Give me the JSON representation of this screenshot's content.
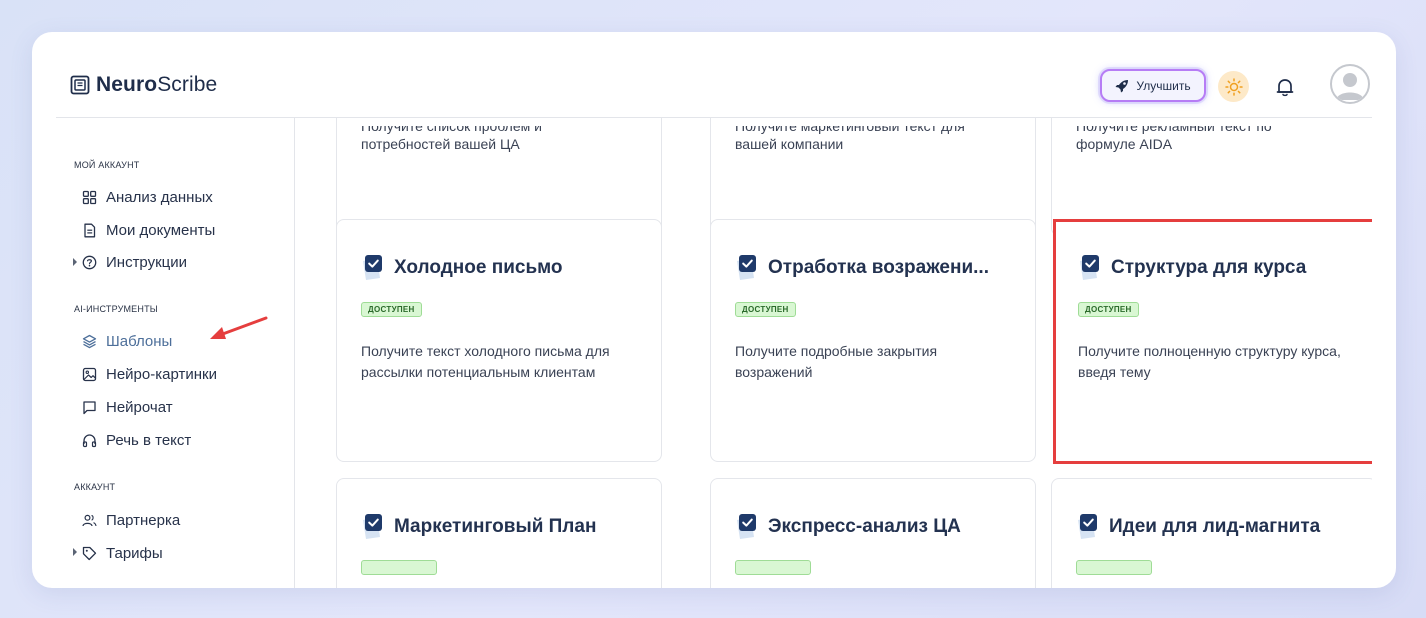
{
  "app": {
    "logo_bold": "Neuro",
    "logo_rest": "Scribe"
  },
  "header": {
    "upgrade_label": "Улучшить",
    "icons": [
      "rocket-icon",
      "sun-icon",
      "bell-icon",
      "avatar"
    ]
  },
  "sidebar": {
    "sections": [
      {
        "title": "МОЙ АККАУНТ",
        "items": [
          {
            "label": "Анализ данных",
            "icon": "grid-icon"
          },
          {
            "label": "Мои документы",
            "icon": "document-icon",
            "expandable": true
          },
          {
            "label": "Инструкции",
            "icon": "question-icon"
          }
        ]
      },
      {
        "title": "AI-ИНСТРУМЕНТЫ",
        "items": [
          {
            "label": "Шаблоны",
            "icon": "layers-icon",
            "active": true
          },
          {
            "label": "Нейро-картинки",
            "icon": "image-icon"
          },
          {
            "label": "Нейрочат",
            "icon": "chat-icon"
          },
          {
            "label": "Речь в текст",
            "icon": "headphones-icon"
          }
        ]
      },
      {
        "title": "АККАУНТ",
        "items": [
          {
            "label": "Партнерка",
            "icon": "users-icon",
            "expandable": true
          },
          {
            "label": "Тарифы",
            "icon": "tag-icon"
          }
        ]
      }
    ]
  },
  "cards_top_partial": [
    {
      "desc_line1": "Получите список проблем и",
      "desc_line2": "потребностей вашей ЦА"
    },
    {
      "desc_line1": "Получите маркетинговый текст для",
      "desc_line2": "вашей компании"
    },
    {
      "desc_line1": "Получите рекламный текст по",
      "desc_line2": "формуле AIDA"
    }
  ],
  "cards": [
    {
      "title": "Холодное письмо",
      "badge": "ДОСТУПЕН",
      "description": "Получите текст холодного письма для рассылки потенциальным клиентам"
    },
    {
      "title": "Отработка возражени...",
      "badge": "ДОСТУПЕН",
      "description": "Получите подробные закрытия возражений"
    },
    {
      "title": "Структура для курса",
      "badge": "ДОСТУПЕН",
      "description": "Получите полноценную структуру курса, введя тему",
      "selected": true
    }
  ],
  "cards_bottom_partial": [
    {
      "title": "Маркетинговый План"
    },
    {
      "title": "Экспресс-анализ ЦА"
    },
    {
      "title": "Идеи для лид-магнита"
    }
  ],
  "colors": {
    "accent_text": "#233250",
    "active_nav": "#4d6f9a",
    "badge_bg": "#d9f7d3",
    "selected_border": "#e53e3e",
    "upgrade_border": "#b67cf5"
  }
}
